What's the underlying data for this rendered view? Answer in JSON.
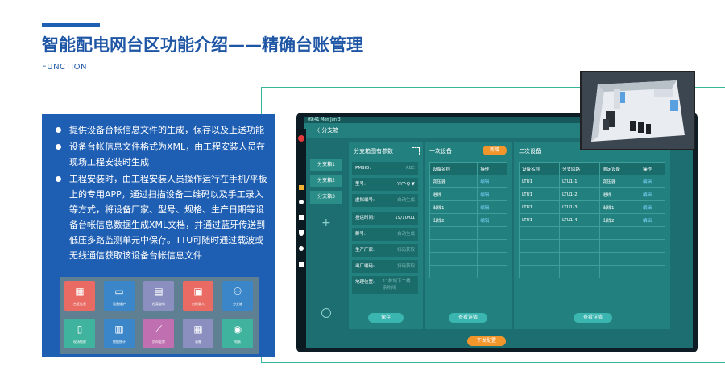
{
  "header": {
    "title": "智能配电网台区功能介绍——精确台账管理",
    "subtitle": "FUNCTION"
  },
  "bullets": [
    "提供设备台帐信息文件的生成，保存以及上送功能",
    "设备台帐信息文件格式为XML，由工程安装人员在现场工程安装时生成",
    "工程安装时，由工程安装人员操作运行在手机/平板上的专用APP，通过扫描设备二维码以及手工录入等方式，将设备厂家、型号、规格、生产日期等设备台帐信息数据生成XML文档，并通过蓝牙传送到低压多路监测单元中保存。TTU可随时通过载波或无线通信获取该设备台帐信息文件"
  ],
  "icon_tiles": [
    {
      "label": "台区信息",
      "icon": "calendar-icon",
      "color": "#e96b63"
    },
    {
      "label": "设备维护",
      "icon": "monitor-icon",
      "color": "#3b86c8"
    },
    {
      "label": "档案查询",
      "icon": "document-icon",
      "color": "#8a8fbf"
    },
    {
      "label": "台账录入",
      "icon": "clipboard-icon",
      "color": "#e96b63"
    },
    {
      "label": "分支箱",
      "icon": "network-icon",
      "color": "#3b86c8"
    },
    {
      "label": "现场勘察",
      "icon": "phone-icon",
      "color": "#3fb39d"
    },
    {
      "label": "数据统计",
      "icon": "barchart-icon",
      "color": "#3b86c8"
    },
    {
      "label": "负荷走势",
      "icon": "linechart-icon",
      "color": "#c06fb0"
    },
    {
      "label": "表箱",
      "icon": "box-icon",
      "color": "#8a8fbf"
    },
    {
      "label": "电表",
      "icon": "meter-icon",
      "color": "#3fb39d"
    }
  ],
  "app": {
    "status_text": "09:41  Mon Jun 3",
    "back_label": "〈  分支箱",
    "branch_items": [
      "分支箱1",
      "分支箱2",
      "分支箱3"
    ],
    "add_symbol": "+",
    "params_title": "分支箱图有参数",
    "fields": [
      {
        "label": "PMSID:",
        "value": "ABC"
      },
      {
        "label": "型号:",
        "value": "YYY-Q ▼"
      },
      {
        "label": "虚拟编号:",
        "value": "自动生成"
      },
      {
        "label": "投运时间:",
        "value": "19/10/01"
      },
      {
        "label": "群号:",
        "value": "自动生成"
      },
      {
        "label": "生产厂家:",
        "value": "扫码获取"
      },
      {
        "label": "出厂编码:",
        "value": "扫码获取"
      },
      {
        "label": "地理位置:",
        "value": "11栋地下二楼 杂物间"
      }
    ],
    "save_button": "保存",
    "primary": {
      "title": "一次设备",
      "add_button": "新增",
      "headers": [
        "设备名称",
        "操作"
      ],
      "rows": [
        [
          "变压器",
          "编辑"
        ],
        [
          "进线",
          "编辑"
        ],
        [
          "出线1",
          "编辑"
        ],
        [
          "出线2",
          "编辑"
        ]
      ],
      "detail_button": "查看详情"
    },
    "secondary": {
      "title": "二次设备",
      "headers": [
        "设备名称",
        "分支回路",
        "绑定设备",
        "操作"
      ],
      "rows": [
        [
          "LTU1",
          "LTU1-1",
          "变压器",
          "编辑"
        ],
        [
          "LTU1",
          "LTU1-2",
          "进线",
          "编辑"
        ],
        [
          "LTU1",
          "LTU1-3",
          "出线1",
          "编辑"
        ],
        [
          "LTU1",
          "LTU1-4",
          "出线2",
          "编辑"
        ]
      ],
      "detail_button": "查看详情"
    },
    "deploy_button": "下发配置"
  }
}
